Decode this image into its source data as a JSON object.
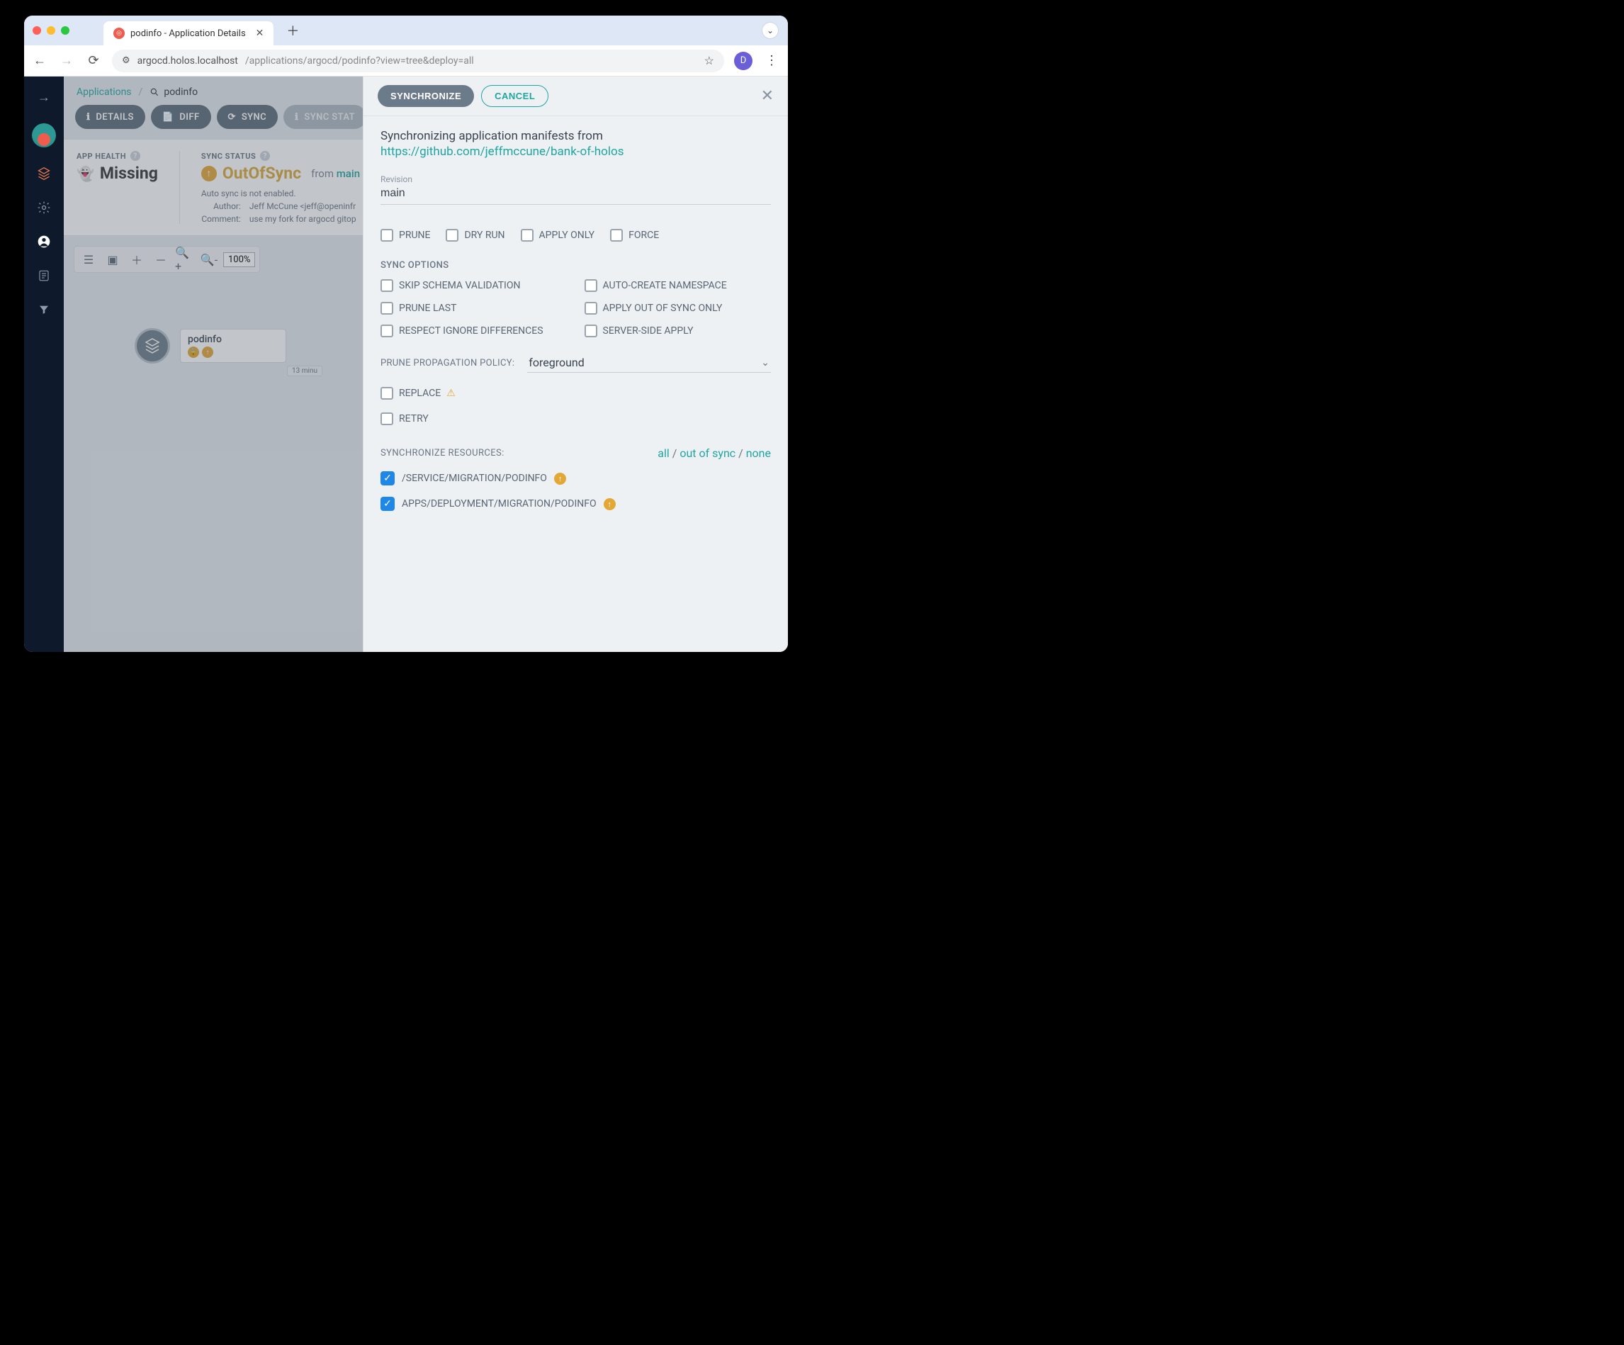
{
  "browser": {
    "tab_title": "podinfo - Application Details",
    "url_host": "argocd.holos.localhost",
    "url_path": "/applications/argocd/podinfo?view=tree&deploy=all",
    "profile_initial": "D"
  },
  "breadcrumb": {
    "applications": "Applications",
    "search": "podinfo"
  },
  "toolbar": {
    "details": "DETAILS",
    "diff": "DIFF",
    "sync": "SYNC",
    "sync_status": "SYNC STAT"
  },
  "status": {
    "health_label": "APP HEALTH",
    "health_value": "Missing",
    "sync_label": "SYNC STATUS",
    "sync_value": "OutOfSync",
    "from": "from",
    "branch": "main",
    "autosync": "Auto sync is not enabled.",
    "author_k": "Author:",
    "author_v": "Jeff McCune <jeff@openinfr",
    "comment_k": "Comment:",
    "comment_v": "use my fork for argocd gitop"
  },
  "zoom": {
    "pct": "100%"
  },
  "node": {
    "title": "podinfo",
    "time": "13 minu"
  },
  "panel": {
    "synchronize": "SYNCHRONIZE",
    "cancel": "CANCEL",
    "text": "Synchronizing application manifests from",
    "link": "https://github.com/jeffmccune/bank-of-holos",
    "revision_label": "Revision",
    "revision_value": "main",
    "prune": "PRUNE",
    "dryrun": "DRY RUN",
    "applyonly": "APPLY ONLY",
    "force": "FORCE",
    "sync_options_hd": "SYNC OPTIONS",
    "opt_skip": "SKIP SCHEMA VALIDATION",
    "opt_autons": "AUTO-CREATE NAMESPACE",
    "opt_prunelast": "PRUNE LAST",
    "opt_oos": "APPLY OUT OF SYNC ONLY",
    "opt_respect": "RESPECT IGNORE DIFFERENCES",
    "opt_ssa": "SERVER-SIDE APPLY",
    "prune_policy_label": "PRUNE PROPAGATION POLICY:",
    "prune_policy_value": "foreground",
    "replace": "REPLACE",
    "retry": "RETRY",
    "sync_res_label": "SYNCHRONIZE RESOURCES:",
    "link_all": "all",
    "link_oos": "out of sync",
    "link_none": "none",
    "res1": "/SERVICE/MIGRATION/PODINFO",
    "res2": "APPS/DEPLOYMENT/MIGRATION/PODINFO"
  }
}
